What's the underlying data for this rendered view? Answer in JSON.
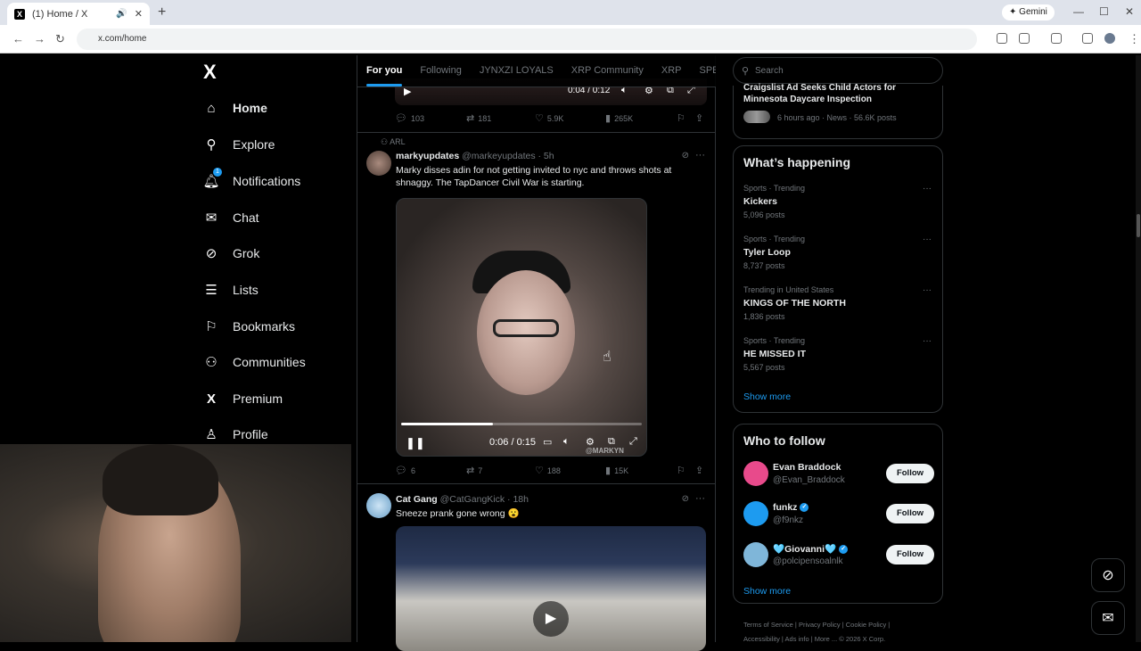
{
  "browser": {
    "tab_title": "(1) Home / X",
    "url": "x.com/home",
    "gemini_label": "Gemini"
  },
  "nav": {
    "logo": "X",
    "items": [
      {
        "label": "Home",
        "icon": "home-icon"
      },
      {
        "label": "Explore",
        "icon": "search-icon"
      },
      {
        "label": "Notifications",
        "icon": "bell-icon",
        "badge": "1"
      },
      {
        "label": "Chat",
        "icon": "mail-icon"
      },
      {
        "label": "Grok",
        "icon": "grok-icon"
      },
      {
        "label": "Lists",
        "icon": "list-icon"
      },
      {
        "label": "Bookmarks",
        "icon": "bookmark-icon"
      },
      {
        "label": "Communities",
        "icon": "communities-icon"
      },
      {
        "label": "Premium",
        "icon": "x-premium-icon"
      },
      {
        "label": "Profile",
        "icon": "profile-icon"
      }
    ]
  },
  "feed": {
    "tabs": [
      "For you",
      "Following",
      "JYNXZI LOYALS",
      "XRP Community",
      "XRP",
      "SPENG"
    ],
    "prev_video": {
      "time": "0:04 / 0:12"
    },
    "prev_actions": {
      "replies": "103",
      "reposts": "181",
      "likes": "5.9K",
      "views": "265K"
    },
    "post1": {
      "community": "ARL",
      "name": "markyupdates",
      "handle": "@markeyupdates",
      "time": "· 5h",
      "text": "Marky disses adin for not getting invited to nyc and throws shots at shnaggy. The TapDancer Civil War is starting.",
      "video_time": "0:06 / 0:15",
      "progress": 0.38,
      "watermark": "@MARKYN",
      "actions": {
        "replies": "6",
        "reposts": "7",
        "likes": "188",
        "views": "15K"
      }
    },
    "post2": {
      "name": "Cat Gang",
      "handle": "@CatGangKick",
      "time": "· 18h",
      "text": "Sneeze prank gone wrong 😮"
    }
  },
  "right": {
    "search_placeholder": "Search",
    "news": {
      "title": "Craigslist Ad Seeks Child Actors for Minnesota Daycare Inspection",
      "meta": "6 hours ago · News · 56.6K posts"
    },
    "happening": {
      "title": "What’s happening",
      "trends": [
        {
          "meta": "Sports · Trending",
          "name": "Kickers",
          "count": "5,096 posts"
        },
        {
          "meta": "Sports · Trending",
          "name": "Tyler Loop",
          "count": "8,737 posts"
        },
        {
          "meta": "Trending in United States",
          "name": "KINGS OF THE NORTH",
          "count": "1,836 posts"
        },
        {
          "meta": "Sports · Trending",
          "name": "HE MISSED IT",
          "count": "5,567 posts"
        }
      ],
      "show_more": "Show more"
    },
    "who_to_follow": {
      "title": "Who to follow",
      "users": [
        {
          "name": "Evan Braddock",
          "handle": "@Evan_Braddock",
          "color": "#e84a8b"
        },
        {
          "name": "funkz",
          "handle": "@f9nkz",
          "color": "#1d9bf0"
        },
        {
          "name": "🩵Giovanni🩵",
          "handle": "@polcipensoalnlk",
          "color": "#7fb6d9"
        }
      ],
      "follow_label": "Follow",
      "show_more": "Show more"
    },
    "footer": {
      "line1": "Terms of Service  |  Privacy Policy  |  Cookie Policy  |",
      "line2": "Accessibility  |  Ads info  |  More ...  © 2026 X Corp."
    }
  },
  "colors": {
    "accent": "#1d9bf0",
    "background": "#000000",
    "border": "#2f3336"
  }
}
